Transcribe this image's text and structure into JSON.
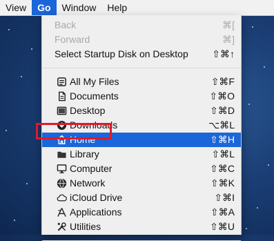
{
  "menubar": {
    "items": [
      {
        "label": "View"
      },
      {
        "label": "Go"
      },
      {
        "label": "Window"
      },
      {
        "label": "Help"
      }
    ]
  },
  "go_menu": {
    "history": [
      {
        "label": "Back",
        "shortcut": "⌘[",
        "enabled": false
      },
      {
        "label": "Forward",
        "shortcut": "⌘]",
        "enabled": false
      },
      {
        "label": "Select Startup Disk on Desktop",
        "shortcut": "⇧⌘↑",
        "enabled": true
      }
    ],
    "locations": [
      {
        "label": "All My Files",
        "shortcut": "⇧⌘F",
        "icon": "all-my-files-icon"
      },
      {
        "label": "Documents",
        "shortcut": "⇧⌘O",
        "icon": "documents-icon"
      },
      {
        "label": "Desktop",
        "shortcut": "⇧⌘D",
        "icon": "desktop-icon"
      },
      {
        "label": "Downloads",
        "shortcut": "⌥⌘L",
        "icon": "downloads-icon"
      },
      {
        "label": "Home",
        "shortcut": "⇧⌘H",
        "icon": "home-icon",
        "selected": true
      },
      {
        "label": "Library",
        "shortcut": "⇧⌘L",
        "icon": "library-icon"
      },
      {
        "label": "Computer",
        "shortcut": "⇧⌘C",
        "icon": "computer-icon"
      },
      {
        "label": "Network",
        "shortcut": "⇧⌘K",
        "icon": "network-icon"
      },
      {
        "label": "iCloud Drive",
        "shortcut": "⇧⌘I",
        "icon": "icloud-drive-icon"
      },
      {
        "label": "Applications",
        "shortcut": "⇧⌘A",
        "icon": "applications-icon"
      },
      {
        "label": "Utilities",
        "shortcut": "⇧⌘U",
        "icon": "utilities-icon"
      }
    ]
  },
  "colors": {
    "selection": "#1b66d8",
    "annotation": "#e0192b",
    "menu_background": "#efefef"
  }
}
